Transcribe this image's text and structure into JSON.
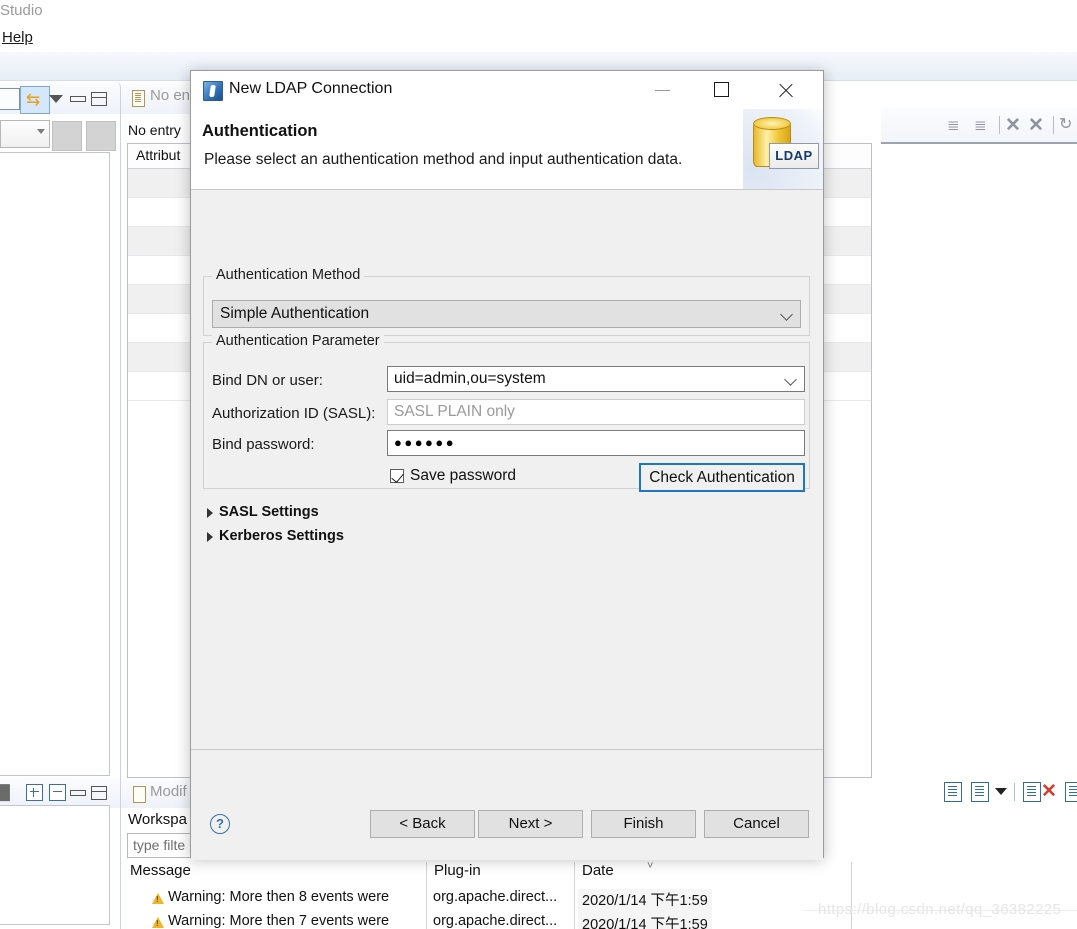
{
  "background": {
    "menu": {
      "studio": "Studio",
      "help": "Help"
    },
    "entry_editor": {
      "tab_label": "No en",
      "subtitle": "No entry",
      "column_header": "Attribut"
    },
    "error_log": {
      "tab_label": "Modif",
      "workspace_label": "Workspa",
      "filter_placeholder": "type filte",
      "columns": [
        "Message",
        "Plug-in",
        "Date"
      ],
      "rows": [
        {
          "message": "Warning: More then 8 events were",
          "plugin": "org.apache.direct...",
          "date": "2020/1/14 下午1:59"
        },
        {
          "message": "Warning: More then 7 events were",
          "plugin": "org.apache.direct...",
          "date": "2020/1/14 下午1:59"
        }
      ]
    },
    "watermark": "https://blog.csdn.net/qq_36382225"
  },
  "dialog": {
    "title": "New LDAP Connection",
    "window_controls": {
      "minimize": "—",
      "maximize": "☐",
      "close": "✕"
    },
    "header": {
      "heading": "Authentication",
      "description": "Please select an authentication method and input authentication data.",
      "badge_text": "LDAP"
    },
    "auth_method": {
      "legend": "Authentication Method",
      "selected": "Simple Authentication",
      "options": [
        "Simple Authentication"
      ]
    },
    "auth_parameter": {
      "legend": "Authentication Parameter",
      "bind_dn_label": "Bind DN or user:",
      "bind_dn_value": "uid=admin,ou=system",
      "authz_id_label": "Authorization ID (SASL):",
      "authz_id_placeholder": "SASL PLAIN only",
      "bind_password_label": "Bind password:",
      "bind_password_value": "●●●●●●",
      "save_password_label": "Save password",
      "save_password_checked": true,
      "check_auth_label": "Check Authentication"
    },
    "sections": [
      {
        "label": "SASL Settings",
        "expanded": false
      },
      {
        "label": "Kerberos Settings",
        "expanded": false
      }
    ],
    "footer": {
      "help_glyph": "?",
      "buttons": [
        "< Back",
        "Next >",
        "Finish",
        "Cancel"
      ]
    }
  },
  "colors": {
    "accent_blue": "#1f74c4",
    "dialog_bg": "#f0f0f0",
    "header_bg": "#ffffff",
    "warning_yellow": "#f0b429",
    "ldap_gold": "#f0c531"
  }
}
